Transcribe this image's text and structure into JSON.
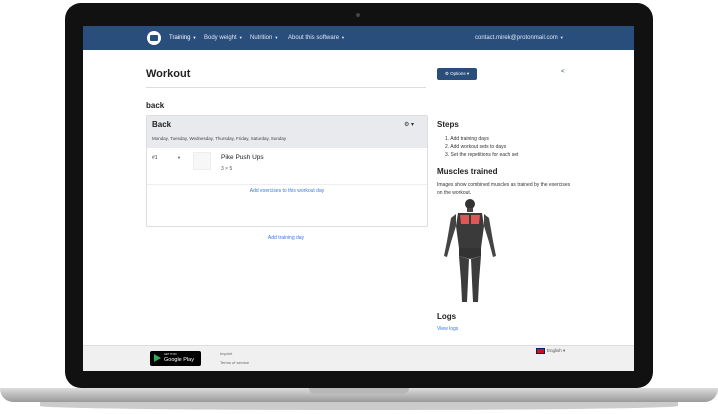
{
  "nav": {
    "items": [
      {
        "label": "Training",
        "active": true
      },
      {
        "label": "Body weight",
        "active": false
      },
      {
        "label": "Nutrition",
        "active": false
      },
      {
        "label": "About this software",
        "active": false
      }
    ],
    "user_email": "contact.mirek@protonmail.com"
  },
  "workout": {
    "title": "Workout",
    "day_label": "back",
    "day": {
      "name": "Back",
      "weekdays": "Monday, Tuesday, Wednesday, Thursday, Friday, Saturday, Sunday"
    },
    "exercises": [
      {
        "number": "#1",
        "name": "Pike Push Ups",
        "sets": "3 × 5"
      }
    ],
    "add_exercises_label": "Add exercises to this workout day",
    "add_day_label": "Add training day"
  },
  "sidebar": {
    "options_label": "Options",
    "steps_title": "Steps",
    "steps": [
      "1. Add training days",
      "2. Add workout sets to days",
      "3. Set the repetitions for each set"
    ],
    "muscles_title": "Muscles trained",
    "muscles_desc": "Images show combined muscles as trained by the exercises on the workout.",
    "logs_title": "Logs",
    "view_logs_label": "View logs"
  },
  "footer": {
    "gplay_small": "GET IT ON",
    "gplay_big": "Google Play",
    "links": [
      "Imprint",
      "Terms of service"
    ],
    "language": "English"
  },
  "colors": {
    "navbar": "#2a4e7c",
    "link": "#3a7bd5",
    "muscle_highlight": "#e05555"
  }
}
